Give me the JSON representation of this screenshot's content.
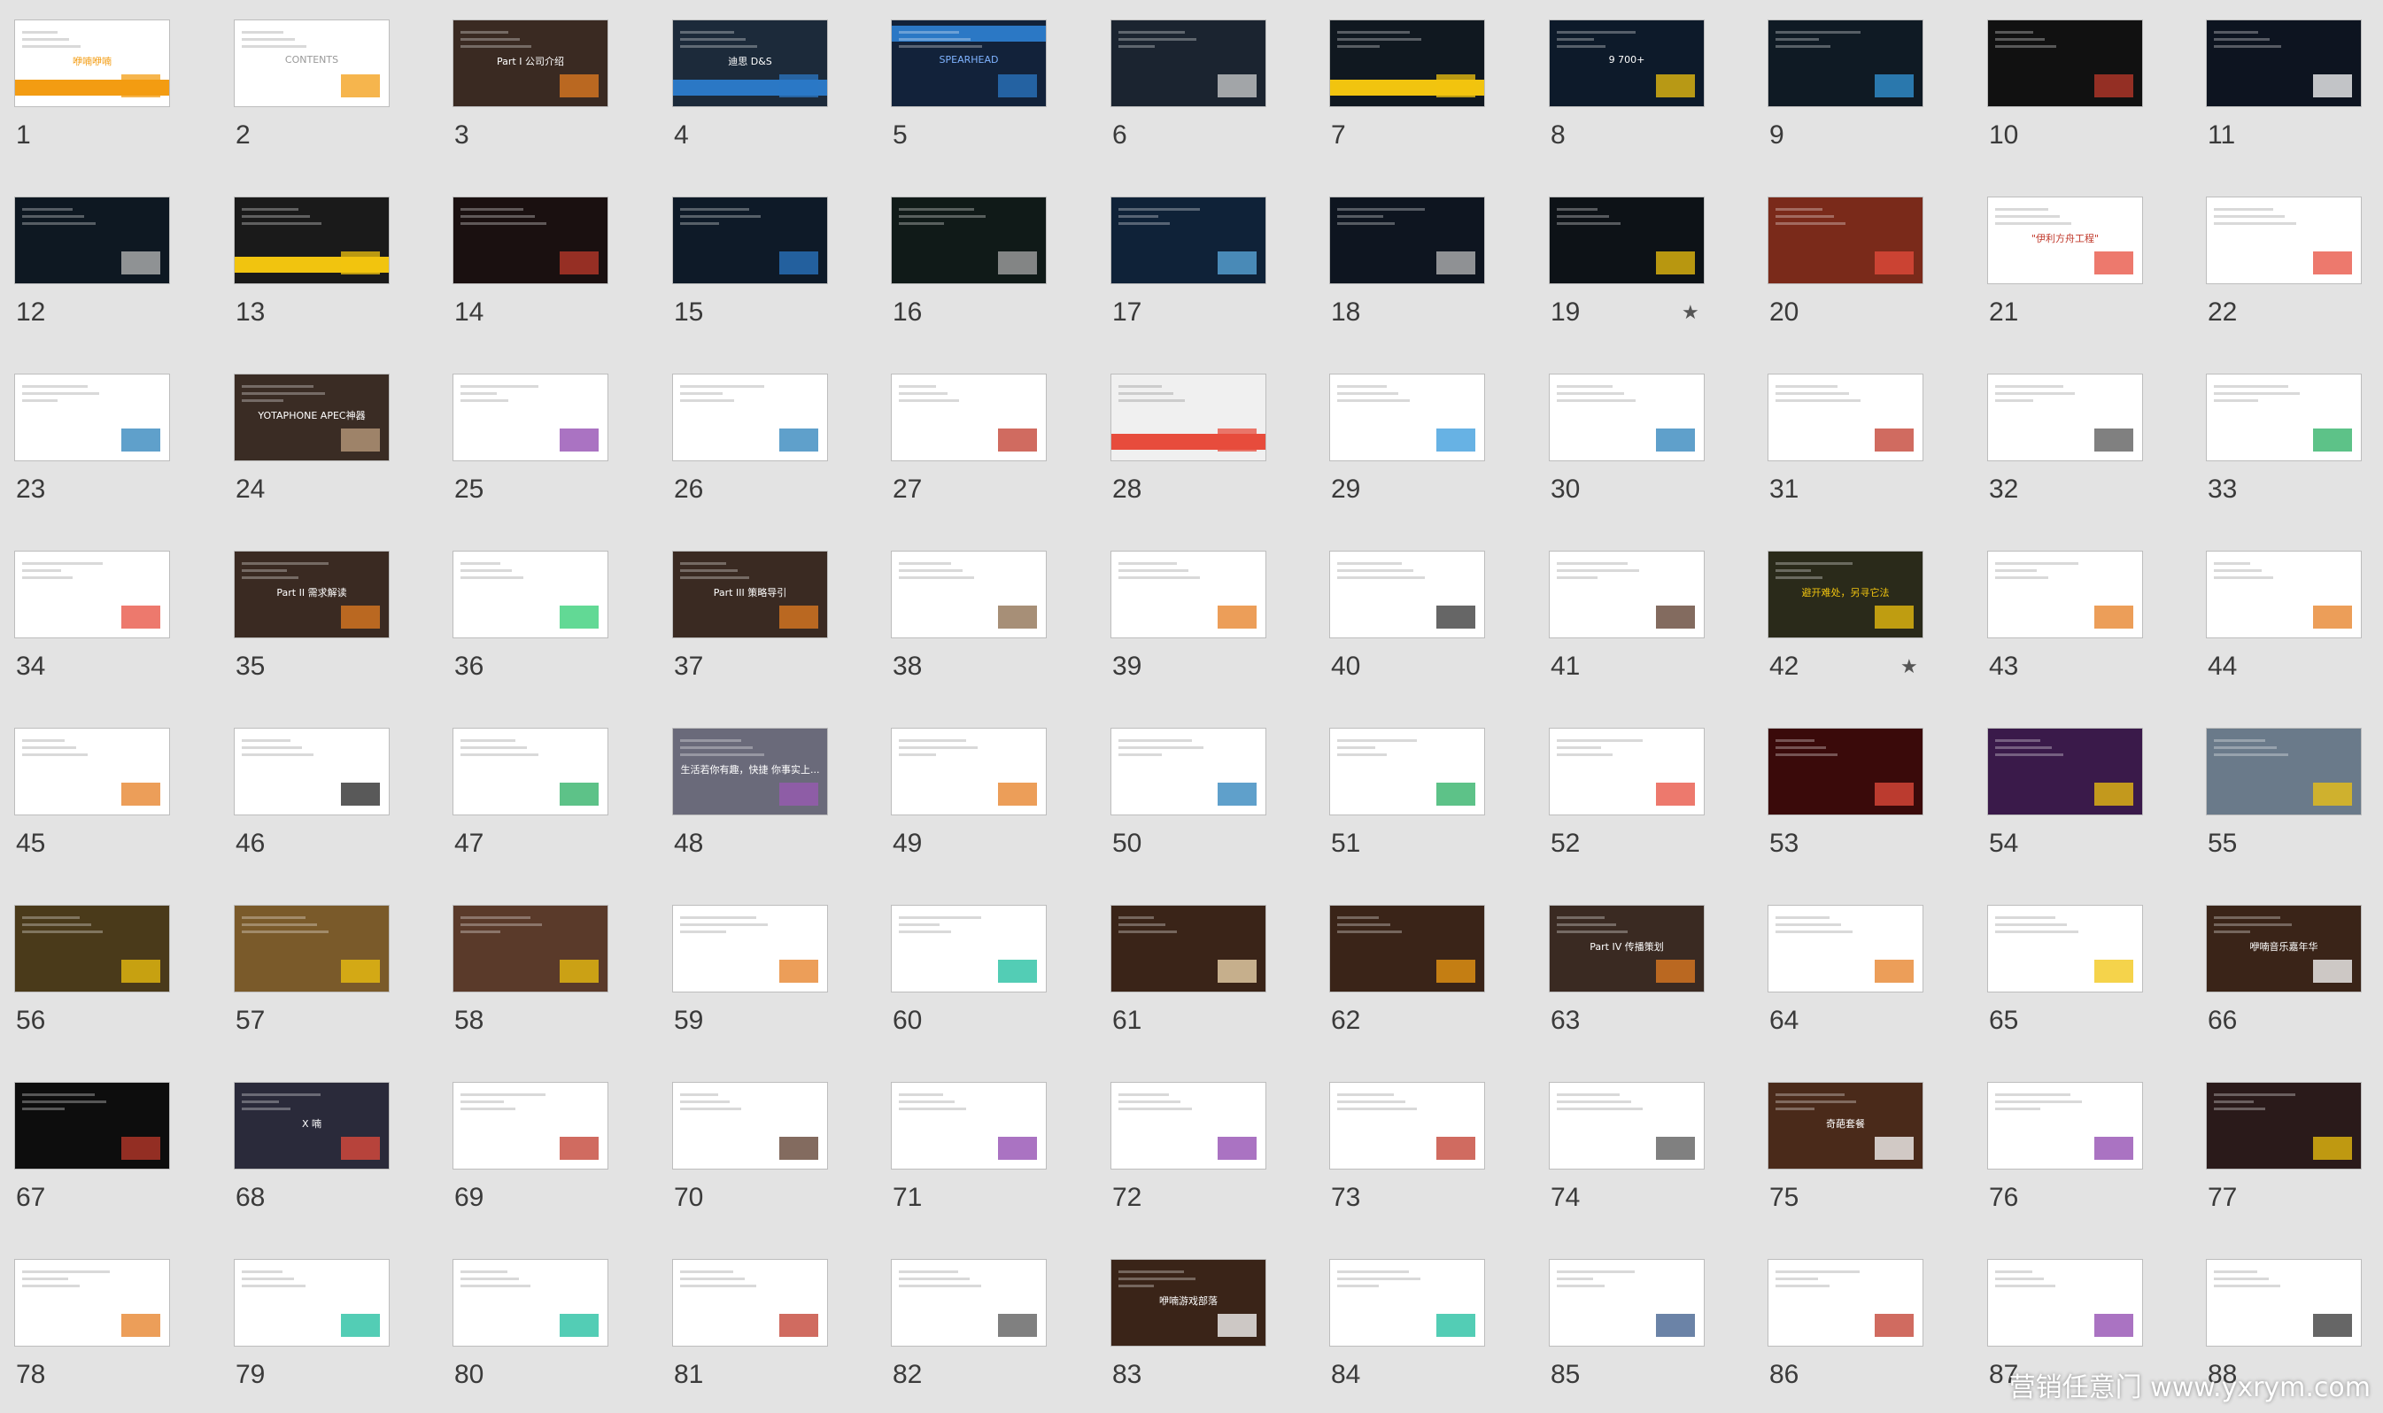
{
  "slides": [
    {
      "n": "1",
      "bg": "#ffffff",
      "accent": "#f39c12",
      "band": "bottom",
      "text": "咿喃咿喃",
      "text_color": "#f39c12"
    },
    {
      "n": "2",
      "bg": "#ffffff",
      "accent": "#f39c12",
      "band": "none",
      "text": "CONTENTS",
      "text_color": "#999999"
    },
    {
      "n": "3",
      "bg": "#3a2a22",
      "accent": "#e67e22",
      "band": "none",
      "text": "Part I 公司介绍",
      "text_color": "#ffffff"
    },
    {
      "n": "4",
      "bg": "#1c2a3a",
      "accent": "#2b78c5",
      "band": "bottom",
      "text": "迪思 D&S",
      "text_color": "#ffffff"
    },
    {
      "n": "5",
      "bg": "#12223a",
      "accent": "#2b78c5",
      "band": "top",
      "text": "SPEARHEAD",
      "text_color": "#7fb3ff"
    },
    {
      "n": "6",
      "bg": "#1b2430",
      "accent": "#d0d0d0",
      "band": "none",
      "text": "",
      "text_color": "#ffffff"
    },
    {
      "n": "7",
      "bg": "#101820",
      "accent": "#f1c40f",
      "band": "bottom",
      "text": "",
      "text_color": "#ffffff"
    },
    {
      "n": "8",
      "bg": "#0d1a2a",
      "accent": "#f1c40f",
      "band": "none",
      "text": "9 700+",
      "text_color": "#ffffff"
    },
    {
      "n": "9",
      "bg": "#0f1a24",
      "accent": "#3498db",
      "band": "none",
      "text": "",
      "text_color": "#ffffff"
    },
    {
      "n": "10",
      "bg": "#111111",
      "accent": "#c0392b",
      "band": "none",
      "text": "",
      "text_color": "#ffffff"
    },
    {
      "n": "11",
      "bg": "#0d1420",
      "accent": "#ffffff",
      "band": "none",
      "text": "",
      "text_color": "#ffffff"
    },
    {
      "n": "12",
      "bg": "#0e1822",
      "accent": "#bbbbbb",
      "band": "none",
      "text": "",
      "text_color": "#ffffff"
    },
    {
      "n": "13",
      "bg": "#1a1a1a",
      "accent": "#f1c40f",
      "band": "bottom",
      "text": "",
      "text_color": "#f1c40f"
    },
    {
      "n": "14",
      "bg": "#1a1010",
      "accent": "#c0392b",
      "band": "none",
      "text": "",
      "text_color": "#ffffff"
    },
    {
      "n": "15",
      "bg": "#0e1a28",
      "accent": "#2b78c5",
      "band": "none",
      "text": "",
      "text_color": "#ffffff"
    },
    {
      "n": "16",
      "bg": "#101a18",
      "accent": "#aaaaaa",
      "band": "none",
      "text": "",
      "text_color": "#ffffff"
    },
    {
      "n": "17",
      "bg": "#0f2238",
      "accent": "#5dade2",
      "band": "none",
      "text": "",
      "text_color": "#ffffff"
    },
    {
      "n": "18",
      "bg": "#0e1520",
      "accent": "#bbbbbb",
      "band": "none",
      "text": "",
      "text_color": "#ffffff"
    },
    {
      "n": "19",
      "bg": "#0d1217",
      "accent": "#f1c40f",
      "band": "none",
      "text": "",
      "text_color": "#f1c40f",
      "star": true
    },
    {
      "n": "20",
      "bg": "#7a2a1a",
      "accent": "#e74c3c",
      "band": "none",
      "text": "",
      "text_color": "#ffffff"
    },
    {
      "n": "21",
      "bg": "#ffffff",
      "accent": "#e74c3c",
      "band": "none",
      "text": "\"伊利方舟工程\"",
      "text_color": "#c0392b"
    },
    {
      "n": "22",
      "bg": "#ffffff",
      "accent": "#e74c3c",
      "band": "none",
      "text": "",
      "text_color": "#333333"
    },
    {
      "n": "23",
      "bg": "#ffffff",
      "accent": "#2980b9",
      "band": "none",
      "text": "",
      "text_color": "#333333"
    },
    {
      "n": "24",
      "bg": "#3a2c24",
      "accent": "#c0a080",
      "band": "none",
      "text": "YOTAPHONE APEC神器",
      "text_color": "#ffffff"
    },
    {
      "n": "25",
      "bg": "#ffffff",
      "accent": "#8e44ad",
      "band": "none",
      "text": "",
      "text_color": "#333333"
    },
    {
      "n": "26",
      "bg": "#ffffff",
      "accent": "#2980b9",
      "band": "none",
      "text": "",
      "text_color": "#333333"
    },
    {
      "n": "27",
      "bg": "#ffffff",
      "accent": "#c0392b",
      "band": "none",
      "text": "",
      "text_color": "#333333"
    },
    {
      "n": "28",
      "bg": "#f0f0f0",
      "accent": "#e74c3c",
      "band": "bottom",
      "text": "",
      "text_color": "#c0392b"
    },
    {
      "n": "29",
      "bg": "#ffffff",
      "accent": "#3498db",
      "band": "none",
      "text": "",
      "text_color": "#333333"
    },
    {
      "n": "30",
      "bg": "#ffffff",
      "accent": "#2980b9",
      "band": "none",
      "text": "",
      "text_color": "#333333"
    },
    {
      "n": "31",
      "bg": "#ffffff",
      "accent": "#c0392b",
      "band": "none",
      "text": "",
      "text_color": "#333333"
    },
    {
      "n": "32",
      "bg": "#ffffff",
      "accent": "#555555",
      "band": "none",
      "text": "",
      "text_color": "#333333"
    },
    {
      "n": "33",
      "bg": "#ffffff",
      "accent": "#27ae60",
      "band": "none",
      "text": "",
      "text_color": "#333333"
    },
    {
      "n": "34",
      "bg": "#ffffff",
      "accent": "#e74c3c",
      "band": "none",
      "text": "",
      "text_color": "#333333"
    },
    {
      "n": "35",
      "bg": "#3a2a22",
      "accent": "#e67e22",
      "band": "none",
      "text": "Part II 需求解读",
      "text_color": "#ffffff"
    },
    {
      "n": "36",
      "bg": "#ffffff",
      "accent": "#2ecc71",
      "band": "none",
      "text": "",
      "text_color": "#333333"
    },
    {
      "n": "37",
      "bg": "#3a2a22",
      "accent": "#e67e22",
      "band": "none",
      "text": "Part III 策略导引",
      "text_color": "#ffffff"
    },
    {
      "n": "38",
      "bg": "#ffffff",
      "accent": "#8a6a4a",
      "band": "none",
      "text": "",
      "text_color": "#333333"
    },
    {
      "n": "39",
      "bg": "#ffffff",
      "accent": "#e67e22",
      "band": "none",
      "text": "",
      "text_color": "#e67e22"
    },
    {
      "n": "40",
      "bg": "#ffffff",
      "accent": "#333333",
      "band": "none",
      "text": "",
      "text_color": "#333333"
    },
    {
      "n": "41",
      "bg": "#ffffff",
      "accent": "#5a3a2a",
      "band": "none",
      "text": "",
      "text_color": "#333333"
    },
    {
      "n": "42",
      "bg": "#2a2a1a",
      "accent": "#f1c40f",
      "band": "none",
      "text": "避开难处，另寻它法",
      "text_color": "#f1c40f",
      "star": true
    },
    {
      "n": "43",
      "bg": "#ffffff",
      "accent": "#e67e22",
      "band": "none",
      "text": "",
      "text_color": "#333333"
    },
    {
      "n": "44",
      "bg": "#ffffff",
      "accent": "#e67e22",
      "band": "none",
      "text": "",
      "text_color": "#333333"
    },
    {
      "n": "45",
      "bg": "#ffffff",
      "accent": "#e67e22",
      "band": "none",
      "text": "",
      "text_color": "#333333"
    },
    {
      "n": "46",
      "bg": "#ffffff",
      "accent": "#222222",
      "band": "none",
      "text": "",
      "text_color": "#333333"
    },
    {
      "n": "47",
      "bg": "#ffffff",
      "accent": "#27ae60",
      "band": "none",
      "text": "",
      "text_color": "#333333"
    },
    {
      "n": "48",
      "bg": "#6a6a7a",
      "accent": "#9b59b6",
      "band": "none",
      "text": "生活若你有趣，快捷 你事实上...",
      "text_color": "#ffffff"
    },
    {
      "n": "49",
      "bg": "#ffffff",
      "accent": "#e67e22",
      "band": "none",
      "text": "",
      "text_color": "#333333"
    },
    {
      "n": "50",
      "bg": "#ffffff",
      "accent": "#2980b9",
      "band": "none",
      "text": "",
      "text_color": "#333333"
    },
    {
      "n": "51",
      "bg": "#ffffff",
      "accent": "#27ae60",
      "band": "none",
      "text": "",
      "text_color": "#333333"
    },
    {
      "n": "52",
      "bg": "#ffffff",
      "accent": "#e74c3c",
      "band": "none",
      "text": "",
      "text_color": "#333333"
    },
    {
      "n": "53",
      "bg": "#3a0a0a",
      "accent": "#e74c3c",
      "band": "none",
      "text": "",
      "text_color": "#f1c40f"
    },
    {
      "n": "54",
      "bg": "#3a1a4a",
      "accent": "#f1c40f",
      "band": "none",
      "text": "",
      "text_color": "#f1c40f"
    },
    {
      "n": "55",
      "bg": "#6a7a8a",
      "accent": "#f1c40f",
      "band": "none",
      "text": "",
      "text_color": "#f1c40f"
    },
    {
      "n": "56",
      "bg": "#4a3a1a",
      "accent": "#f1c40f",
      "band": "none",
      "text": "",
      "text_color": "#f1c40f"
    },
    {
      "n": "57",
      "bg": "#7a5a2a",
      "accent": "#f1c40f",
      "band": "none",
      "text": "",
      "text_color": "#f1c40f"
    },
    {
      "n": "58",
      "bg": "#5a3a2a",
      "accent": "#f1c40f",
      "band": "none",
      "text": "",
      "text_color": "#f1c40f"
    },
    {
      "n": "59",
      "bg": "#ffffff",
      "accent": "#e67e22",
      "band": "none",
      "text": "",
      "text_color": "#e67e22"
    },
    {
      "n": "60",
      "bg": "#ffffff",
      "accent": "#1abc9c",
      "band": "none",
      "text": "",
      "text_color": "#333333"
    },
    {
      "n": "61",
      "bg": "#3a2418",
      "accent": "#f5deb3",
      "band": "none",
      "text": "",
      "text_color": "#f5deb3"
    },
    {
      "n": "62",
      "bg": "#3a2418",
      "accent": "#f39c12",
      "band": "none",
      "text": "",
      "text_color": "#ffffff"
    },
    {
      "n": "63",
      "bg": "#3a2a22",
      "accent": "#e67e22",
      "band": "none",
      "text": "Part IV 传播策划",
      "text_color": "#ffffff"
    },
    {
      "n": "64",
      "bg": "#ffffff",
      "accent": "#e67e22",
      "band": "none",
      "text": "",
      "text_color": "#333333"
    },
    {
      "n": "65",
      "bg": "#ffffff",
      "accent": "#f1c40f",
      "band": "none",
      "text": "",
      "text_color": "#333333"
    },
    {
      "n": "66",
      "bg": "#3a2418",
      "accent": "#ffffff",
      "band": "none",
      "text": "咿喃音乐嘉年华",
      "text_color": "#ffffff"
    },
    {
      "n": "67",
      "bg": "#0d0d0d",
      "accent": "#c0392b",
      "band": "none",
      "text": "",
      "text_color": "#ffffff"
    },
    {
      "n": "68",
      "bg": "#2a2a3a",
      "accent": "#e74c3c",
      "band": "none",
      "text": "X 喃",
      "text_color": "#ffffff"
    },
    {
      "n": "69",
      "bg": "#ffffff",
      "accent": "#c0392b",
      "band": "none",
      "text": "",
      "text_color": "#c0392b"
    },
    {
      "n": "70",
      "bg": "#ffffff",
      "accent": "#5a3a2a",
      "band": "none",
      "text": "",
      "text_color": "#333333"
    },
    {
      "n": "71",
      "bg": "#ffffff",
      "accent": "#8e44ad",
      "band": "none",
      "text": "",
      "text_color": "#333333"
    },
    {
      "n": "72",
      "bg": "#ffffff",
      "accent": "#8e44ad",
      "band": "none",
      "text": "",
      "text_color": "#333333"
    },
    {
      "n": "73",
      "bg": "#ffffff",
      "accent": "#c0392b",
      "band": "none",
      "text": "",
      "text_color": "#333333"
    },
    {
      "n": "74",
      "bg": "#ffffff",
      "accent": "#555555",
      "band": "none",
      "text": "",
      "text_color": "#333333"
    },
    {
      "n": "75",
      "bg": "#4a2a1a",
      "accent": "#ffffff",
      "band": "none",
      "text": "奇葩套餐",
      "text_color": "#ffffff"
    },
    {
      "n": "76",
      "bg": "#ffffff",
      "accent": "#8e44ad",
      "band": "none",
      "text": "",
      "text_color": "#333333"
    },
    {
      "n": "77",
      "bg": "#2a1a1a",
      "accent": "#f1c40f",
      "band": "none",
      "text": "",
      "text_color": "#f1c40f"
    },
    {
      "n": "78",
      "bg": "#ffffff",
      "accent": "#e67e22",
      "band": "none",
      "text": "",
      "text_color": "#333333"
    },
    {
      "n": "79",
      "bg": "#ffffff",
      "accent": "#1abc9c",
      "band": "none",
      "text": "",
      "text_color": "#333333"
    },
    {
      "n": "80",
      "bg": "#ffffff",
      "accent": "#1abc9c",
      "band": "none",
      "text": "",
      "text_color": "#333333"
    },
    {
      "n": "81",
      "bg": "#ffffff",
      "accent": "#c0392b",
      "band": "none",
      "text": "",
      "text_color": "#333333"
    },
    {
      "n": "82",
      "bg": "#ffffff",
      "accent": "#555555",
      "band": "none",
      "text": "",
      "text_color": "#333333"
    },
    {
      "n": "83",
      "bg": "#3a2418",
      "accent": "#ffffff",
      "band": "none",
      "text": "咿喃游戏部落",
      "text_color": "#ffffff"
    },
    {
      "n": "84",
      "bg": "#ffffff",
      "accent": "#1abc9c",
      "band": "none",
      "text": "",
      "text_color": "#333333"
    },
    {
      "n": "85",
      "bg": "#ffffff",
      "accent": "#3a5a8a",
      "band": "none",
      "text": "",
      "text_color": "#333333"
    },
    {
      "n": "86",
      "bg": "#ffffff",
      "accent": "#c0392b",
      "band": "none",
      "text": "",
      "text_color": "#333333"
    },
    {
      "n": "87",
      "bg": "#ffffff",
      "accent": "#8e44ad",
      "band": "none",
      "text": "",
      "text_color": "#333333"
    },
    {
      "n": "88",
      "bg": "#ffffff",
      "accent": "#333333",
      "band": "none",
      "text": "",
      "text_color": "#333333"
    }
  ],
  "watermark": "营销任意门 www.yxrym.com"
}
